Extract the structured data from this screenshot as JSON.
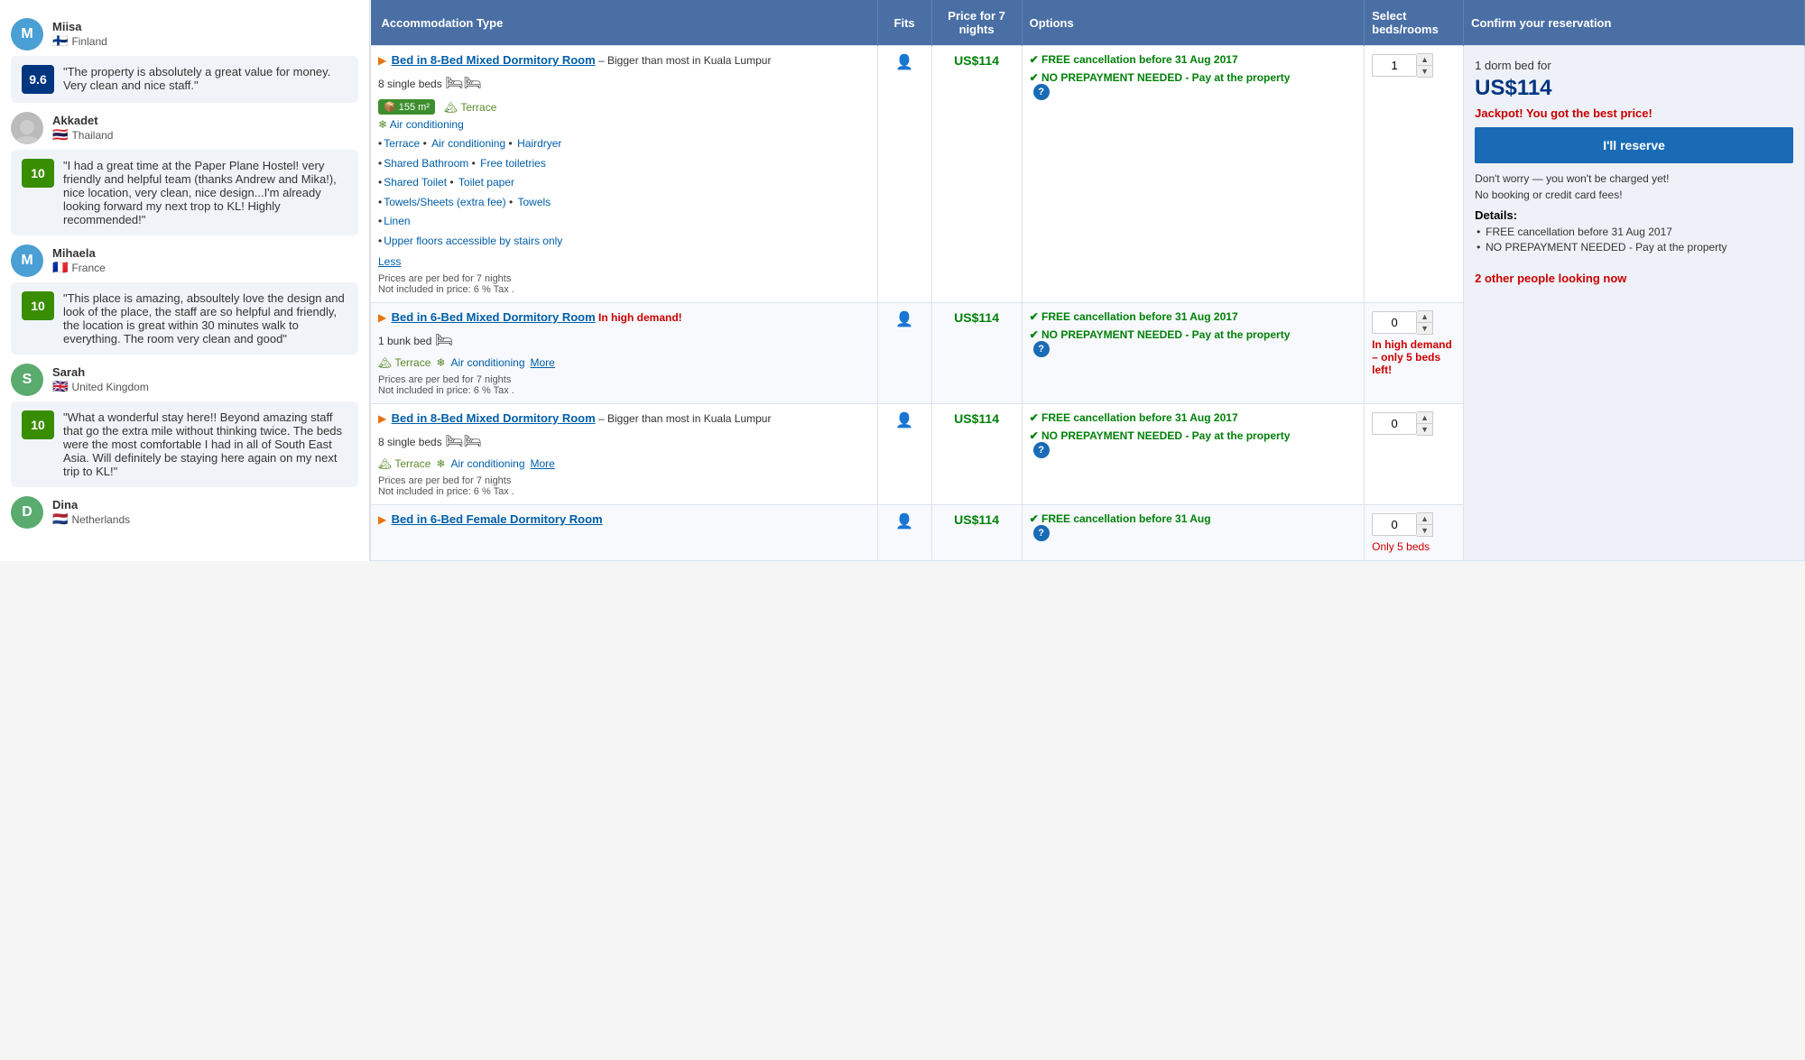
{
  "left": {
    "reviewers": [
      {
        "name": "Miisa",
        "country": "Finland",
        "flag": "🇫🇮",
        "avatarColor": "#4a9fd4",
        "avatarLetter": "M",
        "score": null,
        "review": null
      },
      {
        "name": null,
        "country": null,
        "flag": null,
        "avatarColor": null,
        "avatarLetter": null,
        "score": "9.6",
        "scoreColor": "blue",
        "review": "\"The property is absolutely a great value for money. Very clean and nice staff.\""
      },
      {
        "name": "Akkadet",
        "country": "Thailand",
        "flag": "🇹🇭",
        "avatarColor": null,
        "avatarLetter": null,
        "isPhoto": true,
        "score": null,
        "review": null
      },
      {
        "name": null,
        "country": null,
        "flag": null,
        "avatarColor": null,
        "avatarLetter": null,
        "score": "10",
        "scoreColor": "green",
        "review": "\"I had a great time at the Paper Plane Hostel! very friendly and helpful team (thanks Andrew and Mika!), nice location, very clean, nice design...I'm already looking forward my next trop to KL! Highly recommended!\""
      },
      {
        "name": "Mihaela",
        "country": "France",
        "flag": "🇫🇷",
        "avatarColor": "#4a9fd4",
        "avatarLetter": "M",
        "score": null,
        "review": null
      },
      {
        "name": null,
        "country": null,
        "flag": null,
        "avatarColor": null,
        "avatarLetter": null,
        "score": "10",
        "scoreColor": "green",
        "review": "\"This place is amazing, absoultely love the design and look of the place, the staff are so helpful and friendly, the location is great within 30 minutes walk to everything. The room very clean and good\""
      },
      {
        "name": "Sarah",
        "country": "United Kingdom",
        "flag": "🇬🇧",
        "avatarColor": "#5aab6e",
        "avatarLetter": "S",
        "score": null,
        "review": null
      },
      {
        "name": null,
        "country": null,
        "flag": null,
        "avatarColor": null,
        "avatarLetter": null,
        "score": "10",
        "scoreColor": "green",
        "review": "\"What a wonderful stay here!! Beyond amazing staff that go the extra mile without thinking twice. The beds were the most comfortable I had in all of South East Asia. Will definitely be staying here again on my next trip to KL!\""
      },
      {
        "name": "Dina",
        "country": "Netherlands",
        "flag": "🇳🇱",
        "avatarColor": "#5aab6e",
        "avatarLetter": "D",
        "score": null,
        "review": null
      }
    ]
  },
  "table": {
    "headers": [
      "Accommodation Type",
      "Fits",
      "Price for 7 nights",
      "Options",
      "Select beds/rooms",
      "Confirm your reservation"
    ],
    "rows": [
      {
        "roomName": "Bed in 8-Bed Mixed Dormitory Room",
        "roomDesc": "– Bigger than most in Kuala Lumpur",
        "highDemand": "",
        "bedInfo": "8 single beds",
        "area": "155 m²",
        "hasAc": true,
        "hasTerrace": true,
        "amenities": [
          "Terrace",
          "Air conditioning",
          "Hairdryer",
          "Shared Bathroom",
          "Free toiletries",
          "Shared Toilet",
          "Toilet paper",
          "Towels/Sheets (extra fee)",
          "Towels",
          "Linen",
          "Upper floors accessible by stairs only"
        ],
        "showLess": true,
        "showMore": false,
        "priceNote": "Prices are per bed for 7 nights\nNot included in price: 6 % Tax .",
        "price": "US$114",
        "freeCancel": "FREE cancellation before 31 Aug 2017",
        "noPrepay": "NO PREPAYMENT NEEDED - Pay at the property",
        "spinnerVal": "1",
        "isConfirmRow": true
      },
      {
        "roomName": "Bed in 6-Bed Mixed Dormitory Room",
        "roomDesc": "",
        "highDemand": "In high demand!",
        "bedInfo": "1 bunk bed",
        "area": "",
        "hasAc": true,
        "hasTerrace": true,
        "amenities": [],
        "showLess": false,
        "showMore": true,
        "priceNote": "Prices are per bed for 7 nights\nNot included in price: 6 % Tax .",
        "price": "US$114",
        "freeCancel": "FREE cancellation before 31 Aug 2017",
        "noPrepay": "NO PREPAYMENT NEEDED - Pay at the property",
        "spinnerVal": "0",
        "inDemandWarn": "In high demand – only 5 beds left!",
        "isConfirmRow": false
      },
      {
        "roomName": "Bed in 8-Bed Mixed Dormitory Room",
        "roomDesc": "– Bigger than most in Kuala Lumpur",
        "highDemand": "",
        "bedInfo": "8 single beds",
        "area": "",
        "hasAc": true,
        "hasTerrace": true,
        "amenities": [],
        "showLess": false,
        "showMore": true,
        "priceNote": "Prices are per bed for 7 nights\nNot included in price: 6 % Tax .",
        "price": "US$114",
        "freeCancel": "FREE cancellation before 31 Aug 2017",
        "noPrepay": "NO PREPAYMENT NEEDED - Pay at the property",
        "spinnerVal": "0",
        "isConfirmRow": false
      },
      {
        "roomName": "Bed in 6-Bed Female Dormitory Room",
        "roomDesc": "",
        "highDemand": "",
        "bedInfo": "",
        "area": "",
        "hasAc": false,
        "hasTerrace": false,
        "amenities": [],
        "showLess": false,
        "showMore": false,
        "priceNote": "",
        "price": "US$114",
        "freeCancel": "FREE cancellation before 31 Aug",
        "noPrepay": "",
        "spinnerVal": "0",
        "onlyLeft": "Only 5 beds",
        "isConfirmRow": false,
        "isPartial": true
      }
    ],
    "confirm": {
      "dormText": "1 dorm bed for",
      "price": "US$114",
      "jackpot": "Jackpot! You got the best price!",
      "reserveBtn": "I'll reserve",
      "note1": "Don't worry — you won't be charged yet!",
      "note2": "No booking or credit card fees!",
      "detailsLabel": "Details:",
      "bullet1": "FREE cancellation before 31 Aug 2017",
      "bullet2": "NO PREPAYMENT NEEDED - Pay at the property",
      "peopleLooking": "2 other people looking now"
    }
  }
}
